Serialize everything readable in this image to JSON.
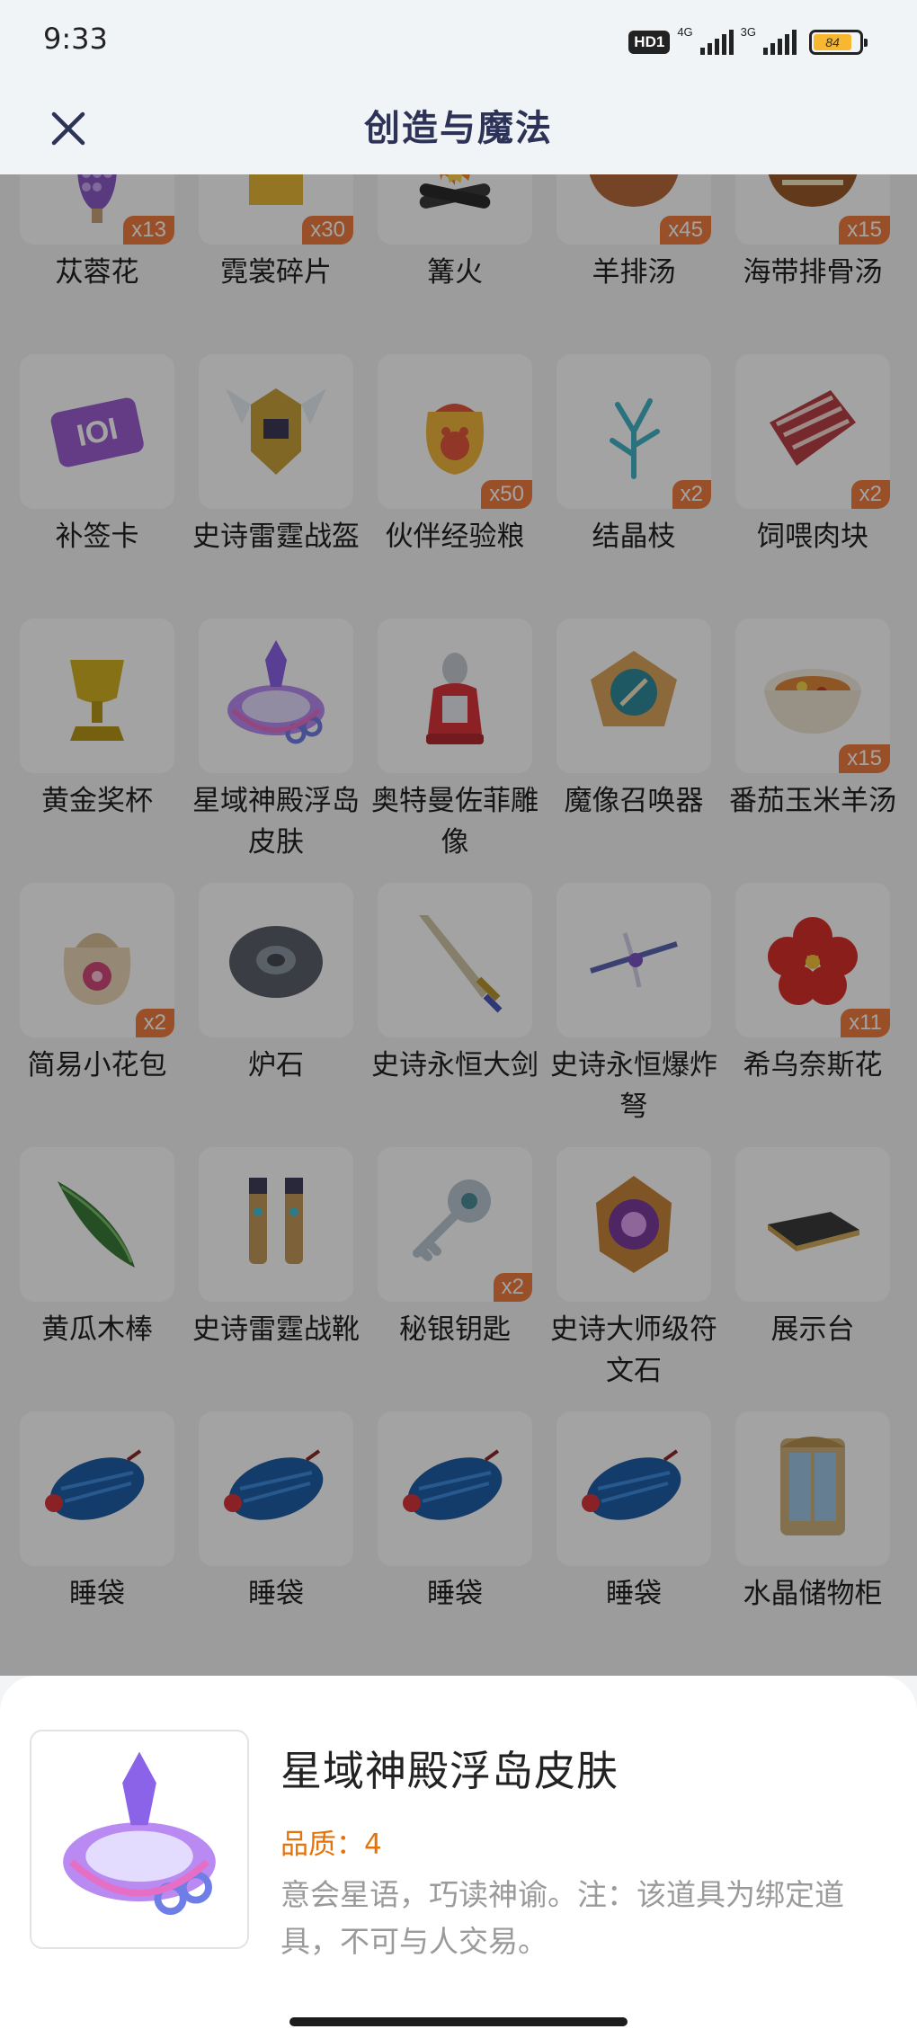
{
  "status_bar": {
    "time": "9:33",
    "hd_badge": "HD1",
    "net1": "4G",
    "net2": "3G",
    "battery": "84"
  },
  "nav": {
    "title": "创造与魔法",
    "close_icon": "close-icon"
  },
  "items": [
    {
      "name": "苁蓉花",
      "qty": "x13",
      "icon": "cistanche-flower"
    },
    {
      "name": "霓裳碎片",
      "qty": "x30",
      "icon": "cloth-shard"
    },
    {
      "name": "篝火",
      "qty": "",
      "icon": "campfire"
    },
    {
      "name": "羊排汤",
      "qty": "x45",
      "icon": "lamb-soup"
    },
    {
      "name": "海带排骨汤",
      "qty": "x15",
      "icon": "kelp-rib-soup"
    },
    {
      "name": "补签卡",
      "qty": "",
      "icon": "checkin-card"
    },
    {
      "name": "史诗雷霆战盔",
      "qty": "",
      "icon": "thunder-helmet"
    },
    {
      "name": "伙伴经验粮",
      "qty": "x50",
      "icon": "pet-food-bag"
    },
    {
      "name": "结晶枝",
      "qty": "x2",
      "icon": "crystal-branch"
    },
    {
      "name": "饲喂肉块",
      "qty": "x2",
      "icon": "meat-chunk"
    },
    {
      "name": "黄金奖杯",
      "qty": "",
      "icon": "golden-trophy"
    },
    {
      "name": "星域神殿浮岛皮肤",
      "qty": "",
      "icon": "floating-island-skin"
    },
    {
      "name": "奥特曼佐菲雕像",
      "qty": "",
      "icon": "ultraman-statue"
    },
    {
      "name": "魔像召唤器",
      "qty": "",
      "icon": "golem-summoner"
    },
    {
      "name": "番茄玉米羊汤",
      "qty": "x15",
      "icon": "tomato-corn-soup"
    },
    {
      "name": "简易小花包",
      "qty": "x2",
      "icon": "flower-pouch"
    },
    {
      "name": "炉石",
      "qty": "",
      "icon": "hearthstone"
    },
    {
      "name": "史诗永恒大剑",
      "qty": "",
      "icon": "eternal-greatsword"
    },
    {
      "name": "史诗永恒爆炸弩",
      "qty": "",
      "icon": "eternal-crossbow"
    },
    {
      "name": "希乌奈斯花",
      "qty": "x11",
      "icon": "red-hibiscus"
    },
    {
      "name": "黄瓜木棒",
      "qty": "",
      "icon": "cucumber-stick"
    },
    {
      "name": "史诗雷霆战靴",
      "qty": "",
      "icon": "thunder-boots"
    },
    {
      "name": "秘银钥匙",
      "qty": "x2",
      "icon": "mithril-key"
    },
    {
      "name": "史诗大师级符文石",
      "qty": "",
      "icon": "master-rune-stone"
    },
    {
      "name": "展示台",
      "qty": "",
      "icon": "display-stand"
    },
    {
      "name": "睡袋",
      "qty": "",
      "icon": "sleeping-bag"
    },
    {
      "name": "睡袋",
      "qty": "",
      "icon": "sleeping-bag"
    },
    {
      "name": "睡袋",
      "qty": "",
      "icon": "sleeping-bag"
    },
    {
      "name": "睡袋",
      "qty": "",
      "icon": "sleeping-bag"
    },
    {
      "name": "水晶储物柜",
      "qty": "",
      "icon": "crystal-cabinet"
    },
    {
      "name": "",
      "qty": "",
      "icon": "partial-item"
    },
    {
      "name": "",
      "qty": "",
      "icon": "partial-item"
    }
  ],
  "detail": {
    "title": "星域神殿浮岛皮肤",
    "quality": "品质：4",
    "description": "意会星语，巧读神谕。注：该道具为绑定道具，不可与人交易。",
    "icon": "floating-island-skin"
  },
  "colors": {
    "accent_quantity": "#ef7e3f",
    "quality_text": "#e5730a",
    "title_navy": "#2c3356"
  }
}
